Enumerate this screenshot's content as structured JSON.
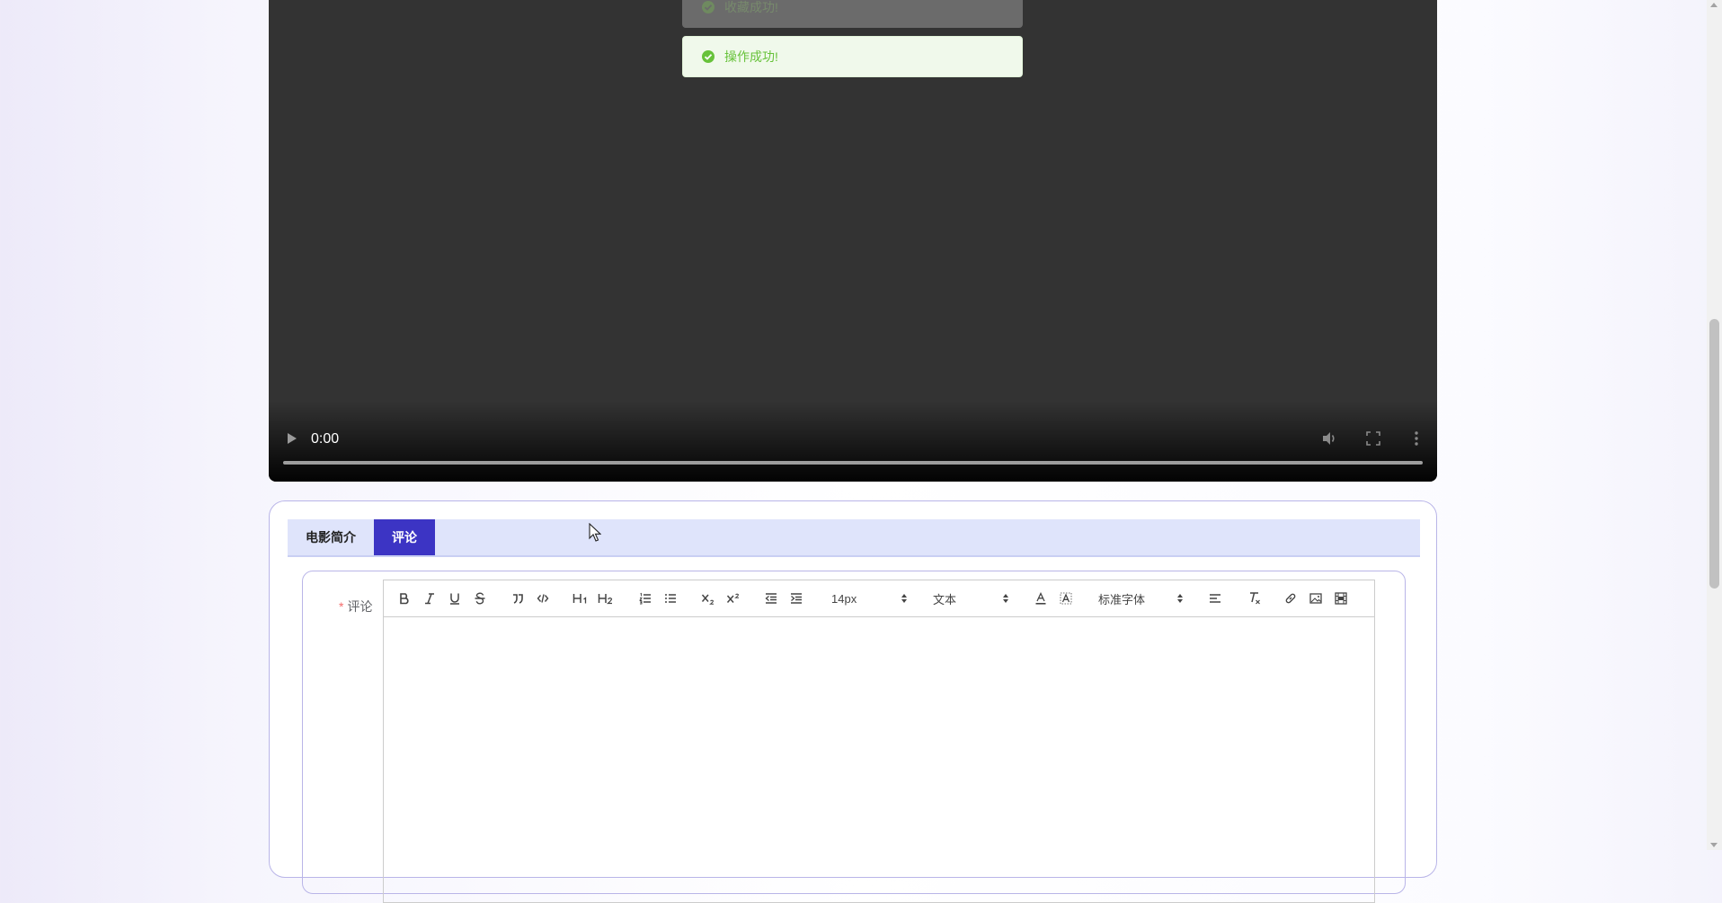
{
  "video": {
    "time": "0:00",
    "icons": [
      "play-icon",
      "volume-icon",
      "fullscreen-icon",
      "more-vert-icon"
    ]
  },
  "toasts": {
    "faded": "收藏成功!",
    "main": "操作成功!",
    "success_color": "#67c23a"
  },
  "tabs": [
    {
      "label": "电影简介",
      "active": false
    },
    {
      "label": "评论",
      "active": true
    }
  ],
  "form": {
    "required_mark": "*",
    "comment_label": "评论"
  },
  "editor": {
    "font_size": "14px",
    "header_select": "文本",
    "font_family": "标准字体",
    "header1": "H1",
    "header2": "H2",
    "icons": [
      "bold-icon",
      "italic-icon",
      "underline-icon",
      "strike-icon",
      "blockquote-icon",
      "code-block-icon",
      "header1-icon",
      "header2-icon",
      "ordered-list-icon",
      "bullet-list-icon",
      "subscript-icon",
      "superscript-icon",
      "outdent-icon",
      "indent-icon",
      "color-icon",
      "background-icon",
      "align-icon",
      "clean-icon",
      "link-icon",
      "image-icon",
      "video-icon"
    ]
  },
  "colors": {
    "accent": "#3c34c4",
    "tabbar": "#dfe4fb",
    "border": "#b9b5e8"
  }
}
